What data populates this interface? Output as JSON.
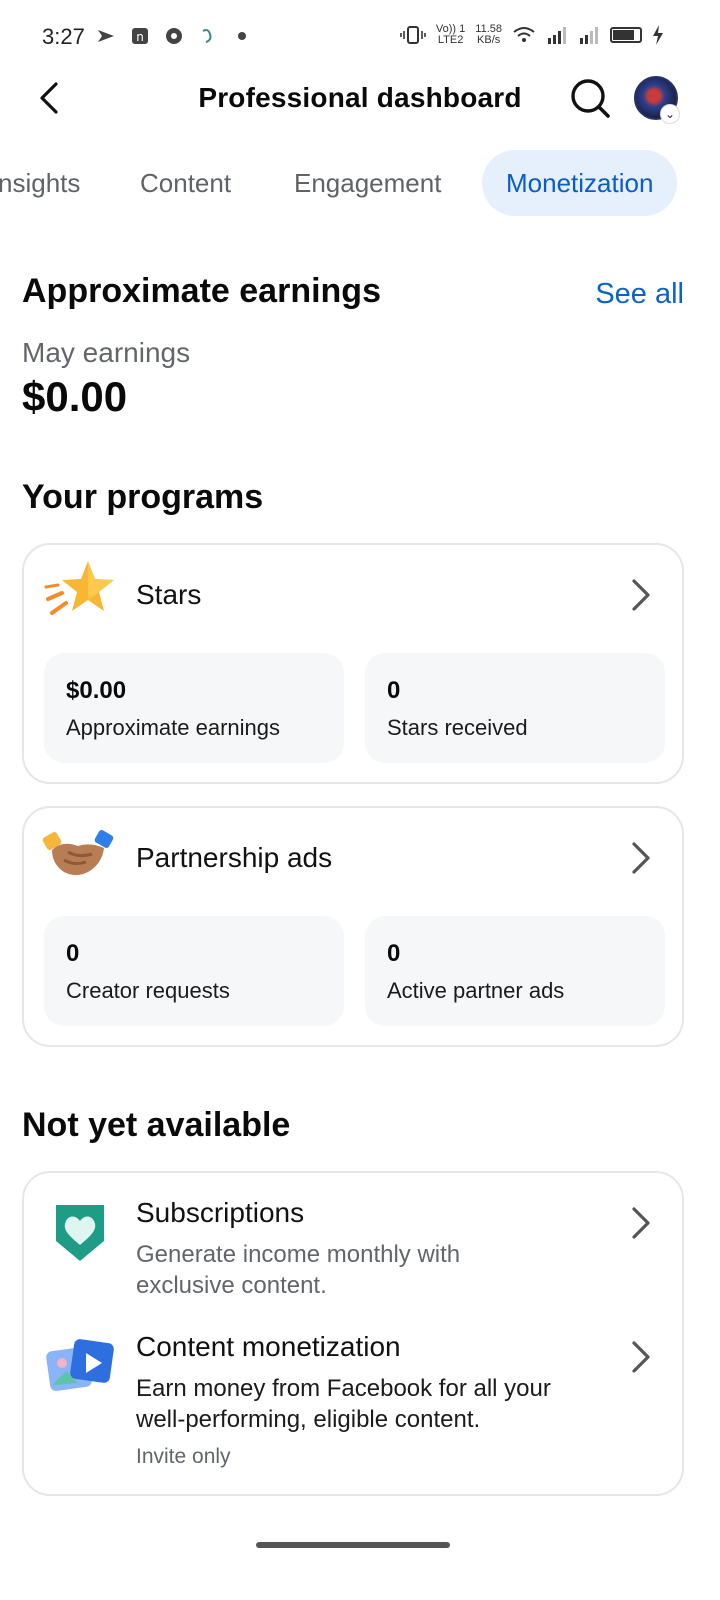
{
  "status_bar": {
    "time": "3:27",
    "net_label_1": "Vo)) 1",
    "net_label_2": "LTE2",
    "speed_value": "11.58",
    "speed_unit": "KB/s"
  },
  "header": {
    "title": "Professional dashboard"
  },
  "tabs": [
    {
      "label": "nsights"
    },
    {
      "label": "Content"
    },
    {
      "label": "Engagement"
    },
    {
      "label": "Monetization",
      "active": true
    }
  ],
  "earnings": {
    "heading": "Approximate earnings",
    "see_all": "See all",
    "month_label": "May earnings",
    "amount": "$0.00"
  },
  "programs": {
    "heading": "Your programs",
    "stars": {
      "title": "Stars",
      "stat1_value": "$0.00",
      "stat1_label": "Approximate earnings",
      "stat2_value": "0",
      "stat2_label": "Stars received"
    },
    "partnership": {
      "title": "Partnership ads",
      "stat1_value": "0",
      "stat1_label": "Creator requests",
      "stat2_value": "0",
      "stat2_label": "Active partner ads"
    }
  },
  "not_available": {
    "heading": "Not yet available",
    "subscriptions": {
      "title": "Subscriptions",
      "desc_line1": "Generate income monthly with",
      "desc_line2": "exclusive content."
    },
    "content_monetization": {
      "title": "Content monetization",
      "desc_line1": "Earn money from Facebook for all your",
      "desc_line2": "well-performing, eligible content.",
      "note": "Invite only"
    }
  },
  "colors": {
    "accent": "#0a64c8",
    "active_tab_bg": "#e6f0fd",
    "card_border": "#e4e6e9",
    "stat_bg": "#f6f7f9"
  }
}
